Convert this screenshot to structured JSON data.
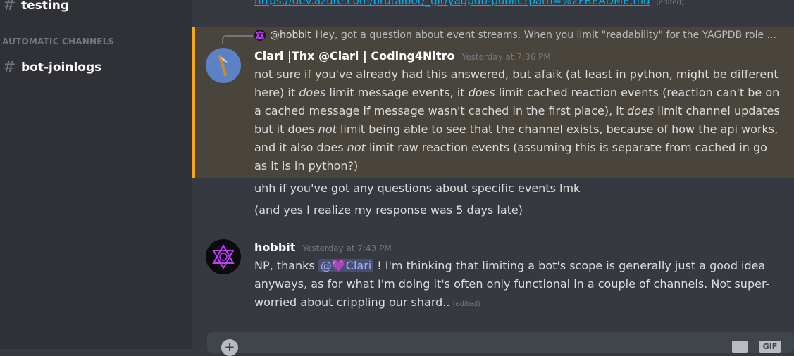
{
  "sidebar": {
    "channels": [
      {
        "icon": "hash-icon",
        "name": "testing"
      },
      {
        "icon": "hash-icon",
        "name": "bot-joinlogs"
      }
    ],
    "category": "AUTOMATIC CHANNELS"
  },
  "chat": {
    "prev_link": "https://dev.azure.com/brutalbot/_git/yagpdb-public?path=%2FREADME.md",
    "prev_edited": "(edited)",
    "highlighted_message": {
      "reply_author": "@hobbit",
      "reply_text": "Hey, got a question about event streams.  When you limit \"readability\" for the YAGPDB role ...",
      "author": "Clari |Thx @Clari | Coding4Nitro",
      "timestamp": "Yesterday at 7:36 PM",
      "line1": "not sure if you've already had this answered, but afaik (at least in python, might be different here) it ",
      "does1": "does",
      "line2": " limit message events, it ",
      "does2": "does",
      "line3": " limit cached reaction events (reaction can't be on a cached message if message wasn't cached in the first place), it ",
      "does3": "does",
      "line4": " limit channel updates but it does ",
      "not1": "not",
      "line5": " limit being able to see that the channel exists, because of how the api works, and it also does ",
      "not2": "not",
      "line6": " limit raw reaction events (assuming this is separate from cached in go as it is in python?)"
    },
    "followups": [
      "uhh if you've got any questions about specific events lmk",
      "(and yes I realize my response was 5 days late)"
    ],
    "hobbit_message": {
      "author": "hobbit",
      "timestamp": "Yesterday at 7:43 PM",
      "text_before": "NP, thanks ",
      "mention_at": "@",
      "mention_heart": "💜",
      "mention_name": "Clari",
      "text_after": " !  I'm thinking that limiting a bot's scope is generally just a good idea anyways, as for what I'm doing it's often only functional in a couple of channels.  Not super-worried about crippling our shard..",
      "edited": "(edited)"
    }
  },
  "composer": {
    "plus_icon": "+",
    "gift_icon": "gift-icon",
    "gif_label": "GIF"
  },
  "colors": {
    "accent_highlight": "#faa61a",
    "link": "#00b0f4",
    "mention_bg": "#414675"
  }
}
